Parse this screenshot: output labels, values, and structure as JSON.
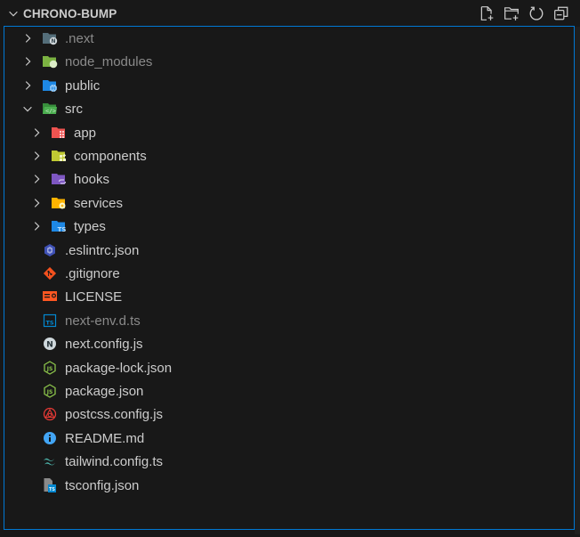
{
  "explorer": {
    "title": "CHRONO-BUMP",
    "actions": [
      {
        "name": "new-file",
        "tooltip": "New File..."
      },
      {
        "name": "new-folder",
        "tooltip": "New Folder..."
      },
      {
        "name": "refresh",
        "tooltip": "Refresh Explorer"
      },
      {
        "name": "collapse-all",
        "tooltip": "Collapse Folders in Explorer"
      }
    ],
    "accent_color": "#0078d4"
  },
  "tree": [
    {
      "label": ".next",
      "type": "folder",
      "expanded": false,
      "depth": 0,
      "dimmed": true,
      "icon": "folder-next-icon"
    },
    {
      "label": "node_modules",
      "type": "folder",
      "expanded": false,
      "depth": 0,
      "dimmed": true,
      "icon": "folder-node-icon"
    },
    {
      "label": "public",
      "type": "folder",
      "expanded": false,
      "depth": 0,
      "dimmed": false,
      "icon": "folder-public-icon"
    },
    {
      "label": "src",
      "type": "folder",
      "expanded": true,
      "depth": 0,
      "dimmed": false,
      "icon": "folder-src-icon"
    },
    {
      "label": "app",
      "type": "folder",
      "expanded": false,
      "depth": 1,
      "dimmed": false,
      "icon": "folder-app-icon"
    },
    {
      "label": "components",
      "type": "folder",
      "expanded": false,
      "depth": 1,
      "dimmed": false,
      "icon": "folder-components-icon"
    },
    {
      "label": "hooks",
      "type": "folder",
      "expanded": false,
      "depth": 1,
      "dimmed": false,
      "icon": "folder-hooks-icon"
    },
    {
      "label": "services",
      "type": "folder",
      "expanded": false,
      "depth": 1,
      "dimmed": false,
      "icon": "folder-services-icon"
    },
    {
      "label": "types",
      "type": "folder",
      "expanded": false,
      "depth": 1,
      "dimmed": false,
      "icon": "folder-types-icon"
    },
    {
      "label": ".eslintrc.json",
      "type": "file",
      "depth": 0,
      "dimmed": false,
      "icon": "eslint-icon"
    },
    {
      "label": ".gitignore",
      "type": "file",
      "depth": 0,
      "dimmed": false,
      "icon": "git-icon"
    },
    {
      "label": "LICENSE",
      "type": "file",
      "depth": 0,
      "dimmed": false,
      "icon": "license-icon"
    },
    {
      "label": "next-env.d.ts",
      "type": "file",
      "depth": 0,
      "dimmed": true,
      "icon": "typescript-def-icon"
    },
    {
      "label": "next.config.js",
      "type": "file",
      "depth": 0,
      "dimmed": false,
      "icon": "nextjs-icon"
    },
    {
      "label": "package-lock.json",
      "type": "file",
      "depth": 0,
      "dimmed": false,
      "icon": "nodejs-icon"
    },
    {
      "label": "package.json",
      "type": "file",
      "depth": 0,
      "dimmed": false,
      "icon": "nodejs-icon"
    },
    {
      "label": "postcss.config.js",
      "type": "file",
      "depth": 0,
      "dimmed": false,
      "icon": "postcss-icon"
    },
    {
      "label": "README.md",
      "type": "file",
      "depth": 0,
      "dimmed": false,
      "icon": "info-icon"
    },
    {
      "label": "tailwind.config.ts",
      "type": "file",
      "depth": 0,
      "dimmed": false,
      "icon": "tailwind-icon"
    },
    {
      "label": "tsconfig.json",
      "type": "file",
      "depth": 0,
      "dimmed": false,
      "icon": "tsconfig-icon"
    }
  ]
}
